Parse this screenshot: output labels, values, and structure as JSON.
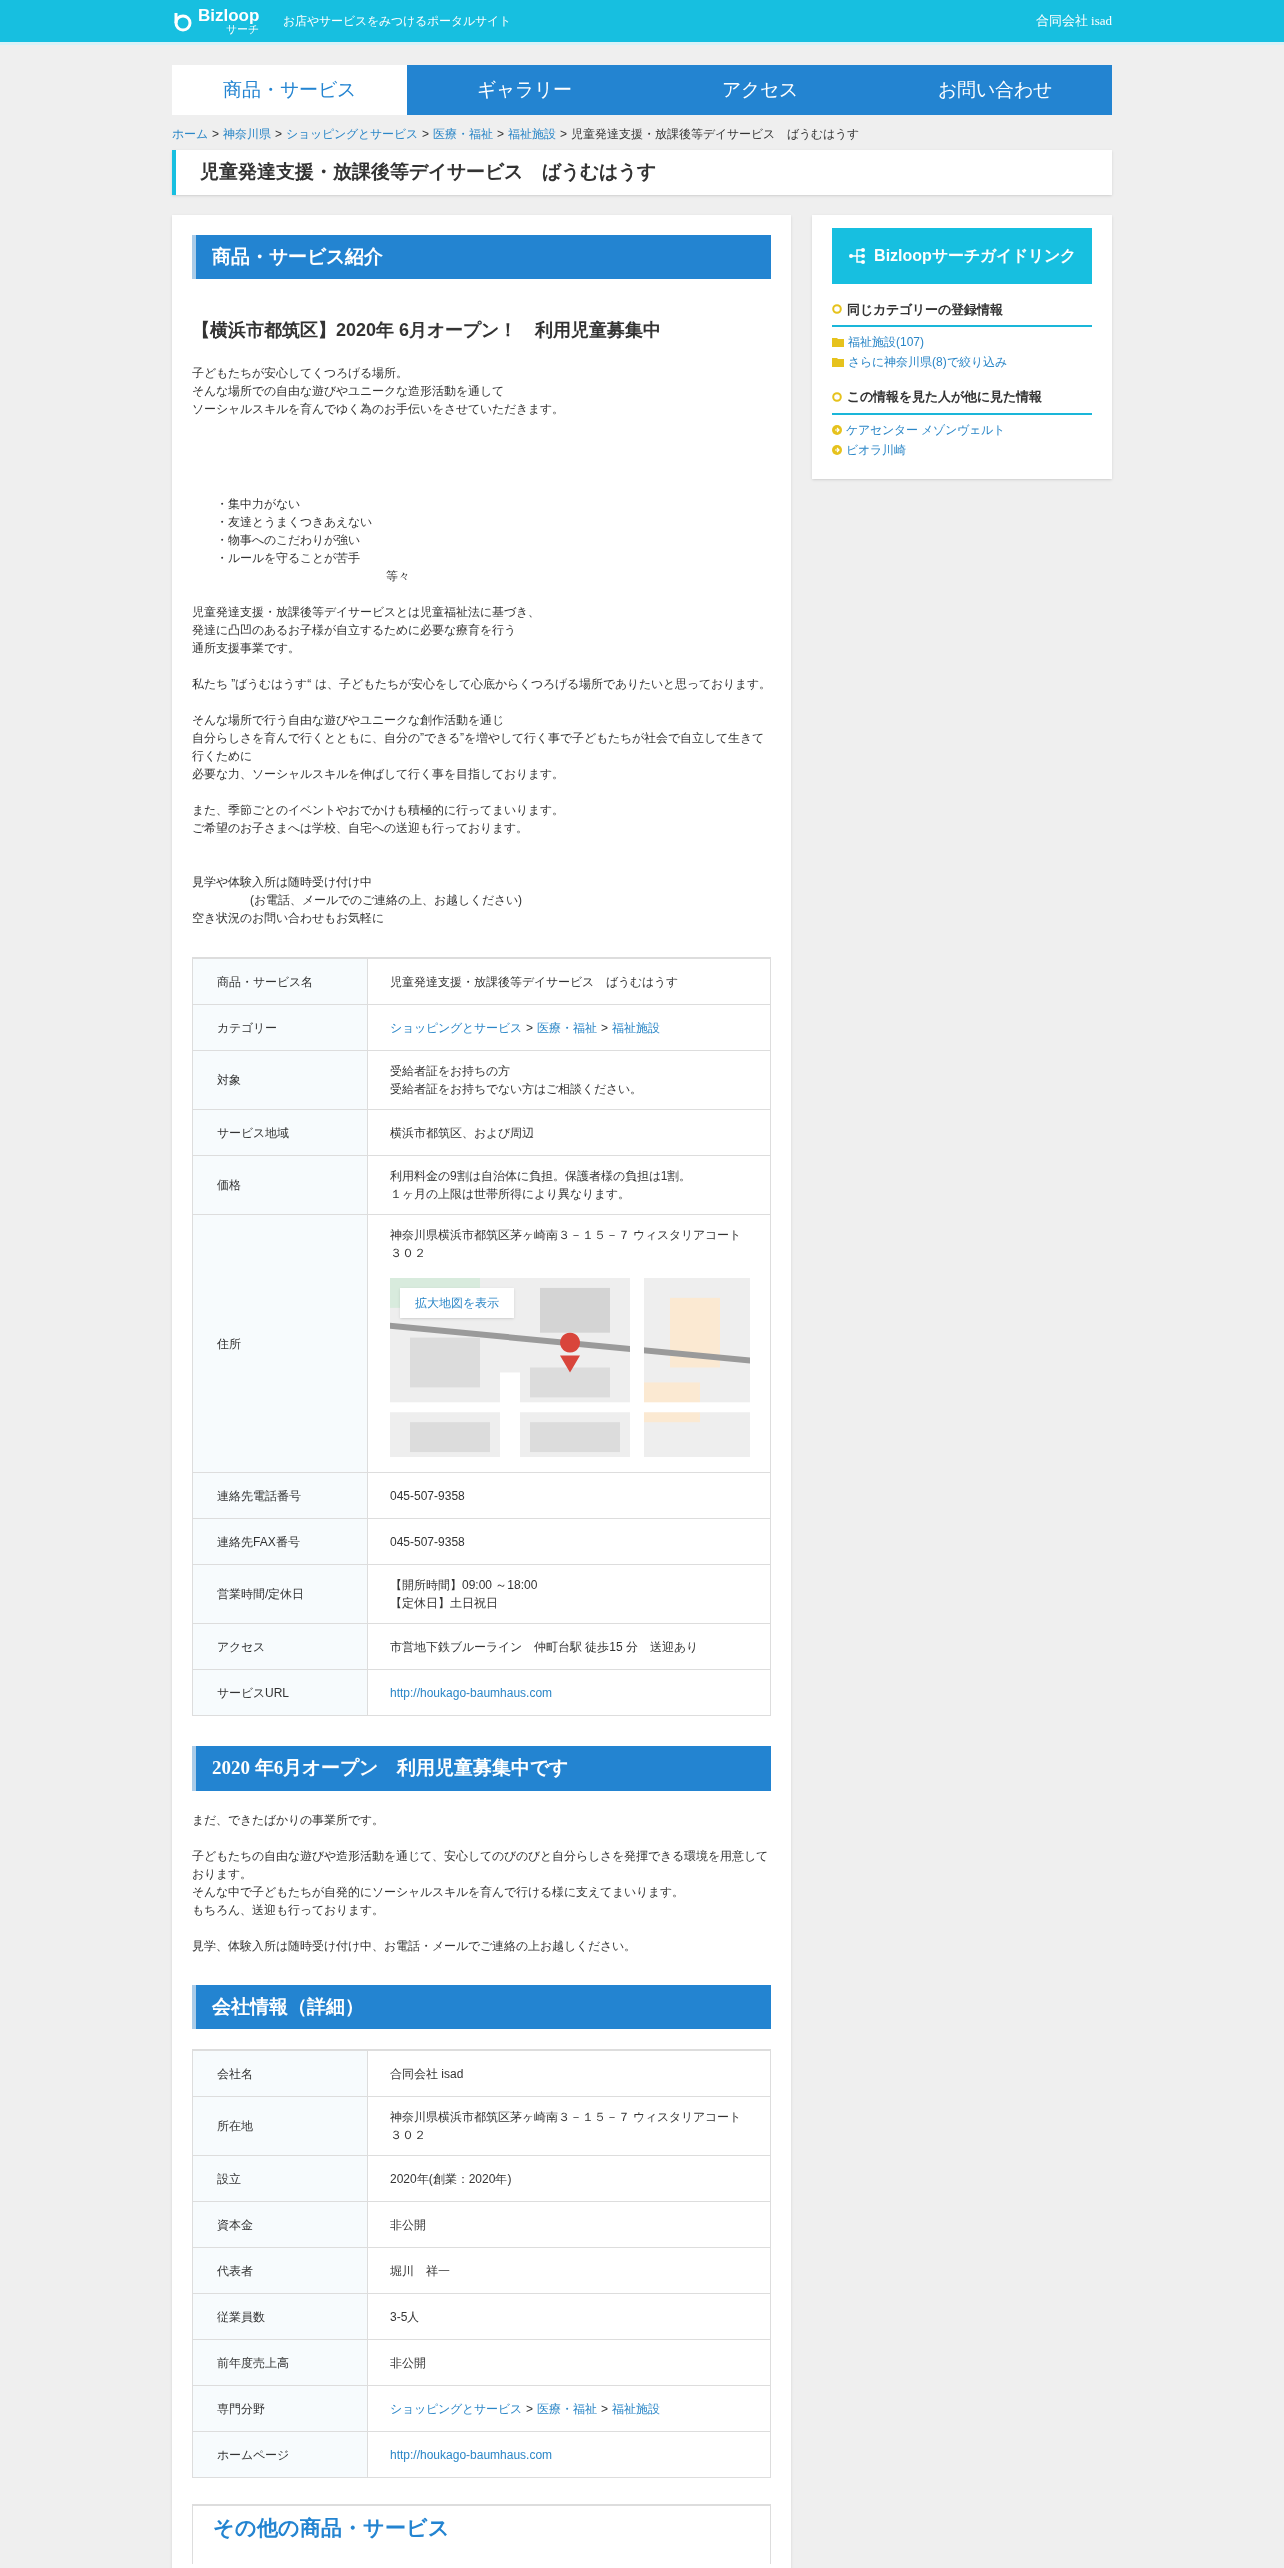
{
  "header": {
    "logo": "Bizloop",
    "logo_sub": "サーチ",
    "tagline": "お店やサービスをみつけるポータルサイト",
    "company": "合同会社 isad"
  },
  "nav": [
    {
      "label": "商品・サービス",
      "selected": true
    },
    {
      "label": "ギャラリー",
      "selected": false
    },
    {
      "label": "アクセス",
      "selected": false
    },
    {
      "label": "お問い合わせ",
      "selected": false
    }
  ],
  "breadcrumb": {
    "separator": ">",
    "items": [
      {
        "label": "ホーム",
        "kind": "link"
      },
      {
        "label": "神奈川県",
        "kind": "link"
      },
      {
        "label": "ショッピングとサービス",
        "kind": "link"
      },
      {
        "label": "医療・福祉",
        "kind": "link"
      },
      {
        "label": "福祉施設",
        "kind": "link"
      },
      {
        "label": "児童発達支援・放課後等デイサービス　ばうむはうす",
        "kind": "text"
      }
    ]
  },
  "page_title": "児童発達支援・放課後等デイサービス　ばうむはうす",
  "intro": {
    "heading": "商品・サービス紹介",
    "subheading": "【横浜市都筑区】2020年 6月オープン！　利用児童募集中",
    "blocks": [
      {
        "kind": "paragraph",
        "lines": [
          "子どもたちが安心してくつろげる場所。",
          "そんな場所での自由な遊びやユニークな造形活動を通して",
          "ソーシャルスキルを育んでゆく為のお手伝いをさせていただきます。"
        ]
      },
      {
        "kind": "list",
        "lines": [
          "・集中力がない",
          "・友達とうまくつきあえない",
          "・物事へのこだわりが強い",
          "・ルールを守ることが苦手"
        ],
        "suffix": "等々"
      },
      {
        "kind": "paragraph",
        "lines": [
          "児童発達支援・放課後等デイサービスとは児童福祉法に基づき、",
          "発達に凸凹のあるお子様が自立するために必要な療育を行う",
          "通所支援事業です。"
        ]
      },
      {
        "kind": "paragraph",
        "lines": [
          "私たち ”ばうむはうす“ は、子どもたちが安心をして心底からくつろげる場所でありたいと思っております。"
        ]
      },
      {
        "kind": "paragraph",
        "lines": [
          "そんな場所で行う自由な遊びやユニークな創作活動を通じ",
          "自分らしさを育んで行くとともに、自分の”できる”を増やして行く事で子どもたちが社会で自立して生きて行くために",
          "必要な力、ソーシャルスキルを伸ばして行く事を目指しております。"
        ]
      },
      {
        "kind": "paragraph",
        "lines": [
          "また、季節ごとのイベントやおでかけも積極的に行ってまいります。",
          "ご希望のお子さまへは学校、自宅への送迎も行っております。"
        ]
      },
      {
        "kind": "contact",
        "lines": [
          {
            "text": "見学や体験入所は随時受け付け中",
            "indented": false
          },
          {
            "text": "(お電話、メールでのご連絡の上、お越しください)",
            "indented": true
          },
          {
            "text": "空き状況のお問い合わせもお気軽に",
            "indented": false
          }
        ]
      }
    ]
  },
  "service_table": [
    {
      "label": "商品・サービス名",
      "kind": "text",
      "lines": [
        "児童発達支援・放課後等デイサービス　ばうむはうす"
      ]
    },
    {
      "label": "カテゴリー",
      "kind": "links",
      "links": [
        "ショッピングとサービス",
        "医療・福祉",
        "福祉施設"
      ],
      "separator": ">"
    },
    {
      "label": "対象",
      "kind": "text",
      "lines": [
        "受給者証をお持ちの方",
        "受給者証をお持ちでない方はご相談ください。"
      ]
    },
    {
      "label": "サービス地域",
      "kind": "text",
      "lines": [
        "横浜市都筑区、および周辺"
      ]
    },
    {
      "label": "価格",
      "kind": "text",
      "lines": [
        "利用料金の9割は自治体に負担。保護者様の負担は1割。",
        "１ヶ月の上限は世帯所得により異なります。"
      ]
    },
    {
      "label": "住所",
      "kind": "map",
      "lines": [
        "神奈川県横浜市都筑区茅ヶ崎南３－１５－７ ウィスタリアコート",
        "３０２"
      ],
      "map_button": "拡大地図を表示"
    },
    {
      "label": "連絡先電話番号",
      "kind": "text",
      "lines": [
        "045-507-9358"
      ]
    },
    {
      "label": "連絡先FAX番号",
      "kind": "text",
      "lines": [
        "045-507-9358"
      ]
    },
    {
      "label": "営業時間/定休日",
      "kind": "text",
      "lines": [
        "【開所時間】09:00 ～18:00",
        "【定休日】土日祝日"
      ]
    },
    {
      "label": "アクセス",
      "kind": "text",
      "lines": [
        "市営地下鉄ブルーライン　仲町台駅 徒歩15 分　送迎あり"
      ]
    },
    {
      "label": "サービスURL",
      "kind": "url",
      "lines": [
        "http://houkago-baumhaus.com"
      ]
    }
  ],
  "opening": {
    "heading": "2020 年6月オープン　利用児童募集中です",
    "paragraphs": [
      [
        "まだ、できたばかりの事業所です。"
      ],
      [
        "子どもたちの自由な遊びや造形活動を通じて、安心してのびのびと自分らしさを発揮できる環境を用意しております。",
        "そんな中で子どもたちが自発的にソーシャルスキルを育んで行ける様に支えてまいります。",
        "もちろん、送迎も行っております。"
      ],
      [
        "見学、体験入所は随時受け付け中、お電話・メールでご連絡の上お越しください。"
      ]
    ]
  },
  "company": {
    "heading": "会社情報（詳細）",
    "rows": [
      {
        "label": "会社名",
        "kind": "text",
        "lines": [
          "合同会社 isad"
        ]
      },
      {
        "label": "所在地",
        "kind": "text",
        "lines": [
          "神奈川県横浜市都筑区茅ヶ崎南３－１５－７ ウィスタリアコート",
          "３０２"
        ]
      },
      {
        "label": "設立",
        "kind": "text",
        "lines": [
          "2020年(創業：2020年)"
        ]
      },
      {
        "label": "資本金",
        "kind": "text",
        "lines": [
          "非公開"
        ]
      },
      {
        "label": "代表者",
        "kind": "text",
        "lines": [
          "堀川　祥一"
        ]
      },
      {
        "label": "従業員数",
        "kind": "text",
        "lines": [
          "3-5人"
        ]
      },
      {
        "label": "前年度売上高",
        "kind": "text",
        "lines": [
          "非公開"
        ]
      },
      {
        "label": "専門分野",
        "kind": "links",
        "links": [
          "ショッピングとサービス",
          "医療・福祉",
          "福祉施設"
        ],
        "separator": ">"
      },
      {
        "label": "ホームページ",
        "kind": "url",
        "lines": [
          "http://houkago-baumhaus.com"
        ]
      }
    ]
  },
  "other_heading": "その他の商品・サービス",
  "sidebar": {
    "guide_button": "Bizloopサーチガイドリンク",
    "sections": [
      {
        "title": "同じカテゴリーの登録情報",
        "kind": "folder",
        "links": [
          "福祉施設(107)",
          "さらに神奈川県(8)で絞り込み"
        ]
      },
      {
        "title": "この情報を見た人が他に見た情報",
        "kind": "arrow",
        "links": [
          "ケアセンター メゾンヴェルト",
          "ビオラ川崎"
        ]
      }
    ]
  }
}
